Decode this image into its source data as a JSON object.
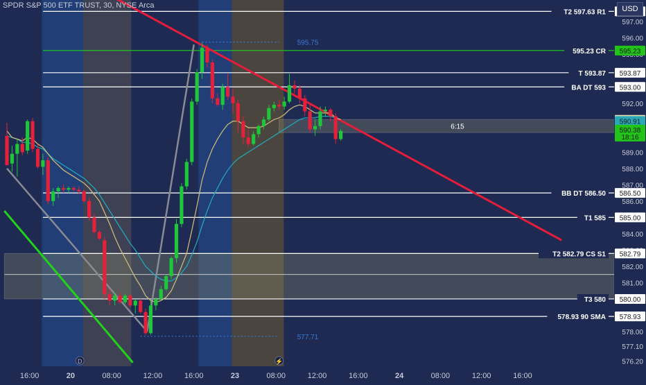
{
  "header": {
    "symbol_line": "SPDR S&P 500 ETF TRUST, 30, NYSE Arca",
    "currency": "USD"
  },
  "colors": {
    "background": "#1e2a52",
    "session_band": "#21407a",
    "premarket_band": "#4a4a55",
    "afterhours_band": "#5b4f3a",
    "candle_up": "#1fc63a",
    "candle_down": "#e3213a",
    "ema_fast": "#c9b77a",
    "ema_slow": "#22a6b6",
    "trendline_red": "#e51d3b",
    "trendline_green": "#22d21a",
    "trendline_gray": "#8a8a95",
    "level_white": "#ffffff",
    "level_green": "#21d21a",
    "dotted_blue": "#3a78d8"
  },
  "chart_data": {
    "type": "candlestick",
    "title": "SPDR S&P 500 ETF TRUST, 30, NYSE Arca",
    "ylim": [
      576.0,
      598.2
    ],
    "y_ticks": [
      576.2,
      577.1,
      578.0,
      579.0,
      580.0,
      581.0,
      582.0,
      583.0,
      584.0,
      585.0,
      586.0,
      587.0,
      588.0,
      589.0,
      590.0,
      591.0,
      592.0,
      593.0,
      594.0,
      595.0,
      596.0,
      597.0
    ],
    "y_tick_labels": [
      "576.20",
      "577.10",
      "578.00",
      "579.00",
      "580.00",
      "581.00",
      "582.00",
      "583.00",
      "584.00",
      "585.00",
      "586.00",
      "587.00",
      "588.00",
      "589.00",
      "590.00",
      "591.00",
      "592.00",
      "593.00",
      "594.00",
      "595.00",
      "596.00",
      "597.00"
    ],
    "x_ticks": [
      {
        "label": "12:00",
        "t": -3.6
      },
      {
        "label": "16:00",
        "t": 4.4
      },
      {
        "label": "20",
        "t": 12.4
      },
      {
        "label": "08:00",
        "t": 20.4
      },
      {
        "label": "12:00",
        "t": 28.4
      },
      {
        "label": "16:00",
        "t": 36.4
      },
      {
        "label": "23",
        "t": 44.4
      },
      {
        "label": "08:00",
        "t": 52.4
      },
      {
        "label": "12:00",
        "t": 60.4
      },
      {
        "label": "16:00",
        "t": 68.4
      },
      {
        "label": "24",
        "t": 76.4
      },
      {
        "label": "08:00",
        "t": 84.4
      },
      {
        "label": "12:00",
        "t": 92.4
      },
      {
        "label": "16:00",
        "t": 100.4
      }
    ],
    "candles": [
      {
        "o": 590.0,
        "h": 590.8,
        "l": 588.3,
        "c": 588.2
      },
      {
        "o": 588.3,
        "h": 589.4,
        "l": 587.8,
        "c": 588.9
      },
      {
        "o": 588.9,
        "h": 589.8,
        "l": 587.5,
        "c": 589.5
      },
      {
        "o": 589.5,
        "h": 589.9,
        "l": 588.8,
        "c": 589.0
      },
      {
        "o": 589.1,
        "h": 591.0,
        "l": 588.9,
        "c": 590.9
      },
      {
        "o": 590.9,
        "h": 591.1,
        "l": 589.0,
        "c": 589.2
      },
      {
        "o": 589.2,
        "h": 589.5,
        "l": 588.0,
        "c": 588.1
      },
      {
        "o": 588.1,
        "h": 588.9,
        "l": 587.6,
        "c": 588.5
      },
      {
        "o": 588.5,
        "h": 588.7,
        "l": 585.8,
        "c": 586.0
      },
      {
        "o": 586.0,
        "h": 586.8,
        "l": 585.7,
        "c": 586.6
      },
      {
        "o": 586.6,
        "h": 586.9,
        "l": 586.2,
        "c": 586.8
      },
      {
        "o": 586.8,
        "h": 587.0,
        "l": 586.5,
        "c": 586.7
      },
      {
        "o": 586.7,
        "h": 586.9,
        "l": 586.5,
        "c": 586.8
      },
      {
        "o": 586.8,
        "h": 586.9,
        "l": 586.6,
        "c": 586.7
      },
      {
        "o": 586.7,
        "h": 586.9,
        "l": 586.4,
        "c": 586.6
      },
      {
        "o": 586.6,
        "h": 586.7,
        "l": 585.9,
        "c": 586.0
      },
      {
        "o": 586.0,
        "h": 586.2,
        "l": 584.8,
        "c": 585.0
      },
      {
        "o": 585.0,
        "h": 585.2,
        "l": 584.0,
        "c": 584.1
      },
      {
        "o": 584.1,
        "h": 584.2,
        "l": 583.6,
        "c": 583.7
      },
      {
        "o": 583.6,
        "h": 583.8,
        "l": 580.0,
        "c": 580.3
      },
      {
        "o": 580.3,
        "h": 580.6,
        "l": 579.6,
        "c": 579.9
      },
      {
        "o": 579.9,
        "h": 580.4,
        "l": 579.6,
        "c": 580.2
      },
      {
        "o": 580.2,
        "h": 580.4,
        "l": 579.7,
        "c": 579.8
      },
      {
        "o": 579.8,
        "h": 580.3,
        "l": 579.7,
        "c": 580.2
      },
      {
        "o": 580.2,
        "h": 580.3,
        "l": 579.5,
        "c": 579.6
      },
      {
        "o": 579.6,
        "h": 580.0,
        "l": 579.1,
        "c": 579.9
      },
      {
        "o": 579.9,
        "h": 580.0,
        "l": 579.1,
        "c": 579.2
      },
      {
        "o": 579.2,
        "h": 579.4,
        "l": 577.8,
        "c": 577.9
      },
      {
        "o": 577.9,
        "h": 579.9,
        "l": 577.8,
        "c": 579.6
      },
      {
        "o": 579.6,
        "h": 580.1,
        "l": 579.3,
        "c": 580.0
      },
      {
        "o": 580.0,
        "h": 580.8,
        "l": 579.9,
        "c": 580.6
      },
      {
        "o": 580.6,
        "h": 581.5,
        "l": 580.5,
        "c": 581.4
      },
      {
        "o": 581.4,
        "h": 582.6,
        "l": 581.2,
        "c": 582.5
      },
      {
        "o": 582.5,
        "h": 584.9,
        "l": 582.2,
        "c": 584.6
      },
      {
        "o": 584.6,
        "h": 587.1,
        "l": 584.4,
        "c": 586.9
      },
      {
        "o": 586.9,
        "h": 588.6,
        "l": 586.7,
        "c": 588.4
      },
      {
        "o": 588.4,
        "h": 592.3,
        "l": 588.2,
        "c": 592.1
      },
      {
        "o": 592.1,
        "h": 594.1,
        "l": 591.9,
        "c": 593.9
      },
      {
        "o": 593.9,
        "h": 595.7,
        "l": 593.5,
        "c": 595.4
      },
      {
        "o": 595.4,
        "h": 595.6,
        "l": 594.2,
        "c": 594.5
      },
      {
        "o": 594.5,
        "h": 594.7,
        "l": 592.0,
        "c": 592.3
      },
      {
        "o": 592.3,
        "h": 592.6,
        "l": 591.8,
        "c": 591.9
      },
      {
        "o": 591.9,
        "h": 593.2,
        "l": 591.6,
        "c": 593.0
      },
      {
        "o": 593.0,
        "h": 593.8,
        "l": 592.2,
        "c": 592.4
      },
      {
        "o": 592.4,
        "h": 592.9,
        "l": 591.4,
        "c": 592.0
      },
      {
        "o": 592.0,
        "h": 592.2,
        "l": 590.2,
        "c": 590.9
      },
      {
        "o": 590.9,
        "h": 591.2,
        "l": 589.5,
        "c": 589.9
      },
      {
        "o": 589.9,
        "h": 590.4,
        "l": 589.3,
        "c": 589.5
      },
      {
        "o": 589.5,
        "h": 590.3,
        "l": 589.4,
        "c": 590.1
      },
      {
        "o": 590.1,
        "h": 590.7,
        "l": 589.9,
        "c": 590.6
      },
      {
        "o": 590.6,
        "h": 591.2,
        "l": 590.4,
        "c": 591.0
      },
      {
        "o": 591.0,
        "h": 591.9,
        "l": 590.9,
        "c": 591.7
      },
      {
        "o": 591.7,
        "h": 592.1,
        "l": 591.5,
        "c": 591.9
      },
      {
        "o": 591.9,
        "h": 592.2,
        "l": 591.6,
        "c": 591.8
      },
      {
        "o": 591.8,
        "h": 592.4,
        "l": 591.6,
        "c": 592.1
      },
      {
        "o": 592.1,
        "h": 593.8,
        "l": 592.0,
        "c": 593.1
      },
      {
        "o": 593.1,
        "h": 593.4,
        "l": 592.6,
        "c": 592.9
      },
      {
        "o": 592.9,
        "h": 593.1,
        "l": 592.0,
        "c": 592.3
      },
      {
        "o": 592.3,
        "h": 592.5,
        "l": 591.2,
        "c": 591.5
      },
      {
        "o": 591.5,
        "h": 591.9,
        "l": 590.2,
        "c": 590.4
      },
      {
        "o": 590.4,
        "h": 591.0,
        "l": 590.0,
        "c": 590.6
      },
      {
        "o": 590.6,
        "h": 591.8,
        "l": 590.4,
        "c": 591.5
      },
      {
        "o": 591.5,
        "h": 591.8,
        "l": 591.2,
        "c": 591.6
      },
      {
        "o": 591.6,
        "h": 591.7,
        "l": 590.9,
        "c": 591.2
      },
      {
        "o": 591.2,
        "h": 591.4,
        "l": 589.5,
        "c": 589.8
      },
      {
        "o": 589.8,
        "h": 590.4,
        "l": 589.7,
        "c": 590.3
      }
    ],
    "ema_fast": [
      590.3,
      589.9,
      589.8,
      589.7,
      589.9,
      589.8,
      589.5,
      589.3,
      588.9,
      588.5,
      588.2,
      587.9,
      587.7,
      587.5,
      587.3,
      587.1,
      586.8,
      586.4,
      586.0,
      585.3,
      584.6,
      583.8,
      583.1,
      582.5,
      581.9,
      581.3,
      580.8,
      580.2,
      579.9,
      579.8,
      579.9,
      580.1,
      580.5,
      581.2,
      582.0,
      582.8,
      584.2,
      585.7,
      587.3,
      588.4,
      589.2,
      589.8,
      590.3,
      590.7,
      590.9,
      590.9,
      590.7,
      590.5,
      590.5,
      590.5,
      590.6,
      590.8,
      591.0,
      591.1,
      591.3,
      591.6,
      591.8,
      591.9,
      591.8,
      591.6,
      591.4,
      591.4,
      591.4,
      591.4,
      591.1,
      591.0
    ],
    "ema_slow": [
      590.0,
      589.9,
      589.8,
      589.6,
      589.6,
      589.5,
      589.3,
      589.2,
      588.9,
      588.6,
      588.4,
      588.2,
      588.0,
      587.8,
      587.6,
      587.4,
      587.1,
      586.8,
      586.4,
      585.9,
      585.4,
      584.9,
      584.4,
      583.9,
      583.4,
      583.0,
      582.5,
      582.0,
      581.7,
      581.4,
      581.2,
      581.1,
      581.1,
      581.3,
      581.6,
      582.0,
      582.7,
      583.5,
      584.5,
      585.4,
      586.2,
      586.8,
      587.4,
      587.9,
      588.3,
      588.6,
      588.8,
      589.0,
      589.2,
      589.4,
      589.6,
      589.8,
      590.0,
      590.2,
      590.4,
      590.6,
      590.8,
      591.0,
      591.1,
      591.1,
      591.1,
      591.2,
      591.2,
      591.2,
      591.1,
      591.0
    ],
    "levels": [
      {
        "price": 597.63,
        "label": "T2 597.63 R1",
        "kind": "white"
      },
      {
        "price": 595.23,
        "label": "595.23 CR",
        "kind": "green"
      },
      {
        "price": 593.87,
        "label": "T 593.87",
        "kind": "white"
      },
      {
        "price": 593.0,
        "label": "BA DT 593",
        "kind": "white"
      },
      {
        "price": 586.5,
        "label": "BB DT 586.50",
        "kind": "white"
      },
      {
        "price": 585.0,
        "label": "T1 585",
        "kind": "white"
      },
      {
        "price": 582.79,
        "label": "T2 582.79 CS S1",
        "kind": "white"
      },
      {
        "price": 580.0,
        "label": "T3 580",
        "kind": "white"
      },
      {
        "price": 578.93,
        "label": "578.93 90 SMA",
        "kind": "white"
      }
    ],
    "price_badges": [
      {
        "price": 597.63,
        "text": "597.63"
      },
      {
        "price": 595.23,
        "text": "595.23",
        "kind": "green"
      },
      {
        "price": 593.87,
        "text": "593.87"
      },
      {
        "price": 593.0,
        "text": "593.00"
      },
      {
        "price": 590.98,
        "text": "590.98",
        "kind": "cream"
      },
      {
        "price": 590.91,
        "text": "590.91",
        "kind": "teal"
      },
      {
        "price": 590.38,
        "text": "590.38",
        "sub": "18:16",
        "kind": "green"
      },
      {
        "price": 586.5,
        "text": "586.50"
      },
      {
        "price": 585.0,
        "text": "585.00"
      },
      {
        "price": 582.79,
        "text": "582.79"
      },
      {
        "price": 580.0,
        "text": "580.00"
      },
      {
        "price": 578.93,
        "text": "578.93"
      }
    ],
    "dotted_levels": [
      {
        "price": 595.75,
        "label": "595.75",
        "t0": 38,
        "t1": 53
      },
      {
        "price": 577.71,
        "label": "577.71",
        "t0": 26,
        "t1": 53
      }
    ],
    "zones": [
      {
        "top": 582.79,
        "bottom": 580.0,
        "t0": -0.5,
        "mid": 581.5
      },
      {
        "top": 591.0,
        "bottom": 590.2,
        "t0": 53,
        "label": "6:15"
      }
    ],
    "trendlines": [
      {
        "kind": "red",
        "t0": 19,
        "p0": 598.8,
        "t1": 108,
        "p1": 583.6
      },
      {
        "kind": "green",
        "t0": -0.5,
        "p0": 585.4,
        "t1": 24.5,
        "p1": 576.1
      },
      {
        "kind": "gray",
        "t0": 0,
        "p0": 588.0,
        "t1": 27.3,
        "p1": 578.0
      },
      {
        "kind": "gray",
        "t0": 27.3,
        "p0": 578.0,
        "t1": 36.4,
        "p1": 595.6
      }
    ],
    "bands": [
      {
        "kind": "session",
        "t0": 6.8,
        "t1": 14.8
      },
      {
        "kind": "premarket",
        "t0": 14.8,
        "t1": 24.2
      },
      {
        "kind": "session",
        "t0": 37.3,
        "t1": 43.8
      },
      {
        "kind": "afterhours",
        "t0": 43.8,
        "t1": 53.9
      }
    ],
    "markers": [
      {
        "text": "D",
        "t": 14.2
      },
      {
        "text": "⚡",
        "t": 53.0
      }
    ]
  }
}
